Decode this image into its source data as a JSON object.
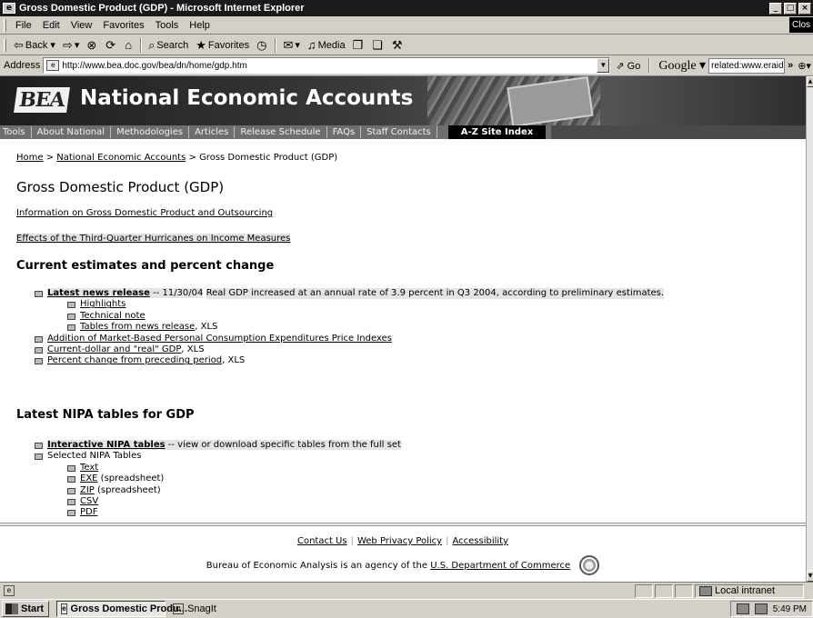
{
  "window": {
    "title": "Gross Domestic Product (GDP) - Microsoft Internet Explorer",
    "close_tab": "Clos"
  },
  "menu": [
    "File",
    "Edit",
    "View",
    "Favorites",
    "Tools",
    "Help"
  ],
  "toolbar": {
    "back": "Back",
    "search": "Search",
    "favorites": "Favorites",
    "media": "Media"
  },
  "address": {
    "label": "Address",
    "url": "http://www.bea.doc.gov/bea/dn/home/gdp.htm",
    "go": "Go",
    "google": "Google",
    "google_query": "related:www.eraide"
  },
  "banner": {
    "logo": "BEA",
    "title": "National Economic Accounts"
  },
  "nav": [
    "Tools",
    "About National",
    "Methodologies",
    "Articles",
    "Release Schedule",
    "FAQs",
    "Staff Contacts"
  ],
  "nav_az": "A-Z Site Index",
  "breadcrumb": {
    "home": "Home",
    "sep": " > ",
    "nea": "National Economic Accounts",
    "current": "Gross Domestic Product (GDP)"
  },
  "page_title": "Gross Domestic Product (GDP)",
  "links": {
    "outsourcing": "Information on Gross Domestic Product and Outsourcing",
    "hurricanes": "Effects of the Third-Quarter Hurricanes on Income Measures"
  },
  "current": {
    "heading": "Current estimates and percent change",
    "release_label": "Latest news release",
    "release_date": " -- 11/30/04",
    "release_desc": "Real GDP increased at an annual rate of 3.9 percent in Q3 2004, according to preliminary estimates.",
    "highlights": "Highlights",
    "technical_note": "Technical note",
    "tables_label": "Tables from news release",
    "tables_suffix": ", XLS",
    "pce": "Addition of Market-Based Personal Consumption Expenditures Price Indexes",
    "current_dollar": "Current-dollar and \"real\" GDP",
    "current_dollar_suffix": ", XLS",
    "pct_change": "Percent change from preceding period",
    "pct_change_suffix": ", XLS"
  },
  "nipa": {
    "heading": "Latest NIPA tables for GDP",
    "interactive": "Interactive NIPA tables",
    "interactive_desc": " -- view or download specific tables from the full set",
    "selected": "Selected NIPA Tables",
    "text": "Text",
    "exe": "EXE",
    "exe_suffix": " (spreadsheet)",
    "zip": "ZIP",
    "zip_suffix": " (spreadsheet)",
    "csv": "CSV",
    "pdf": "PDF"
  },
  "footer": {
    "contact": "Contact Us",
    "privacy": "Web Privacy Policy",
    "accessibility": "Accessibility",
    "agency_prefix": "Bureau of Economic Analysis is an agency of the ",
    "agency_link": "U.S. Department of Commerce"
  },
  "status": {
    "zone": "Local intranet"
  },
  "taskbar": {
    "start": "Start",
    "task_ie": "Gross Domestic Produ...",
    "task_snagit": "SnagIt",
    "clock": "5:49 PM"
  }
}
